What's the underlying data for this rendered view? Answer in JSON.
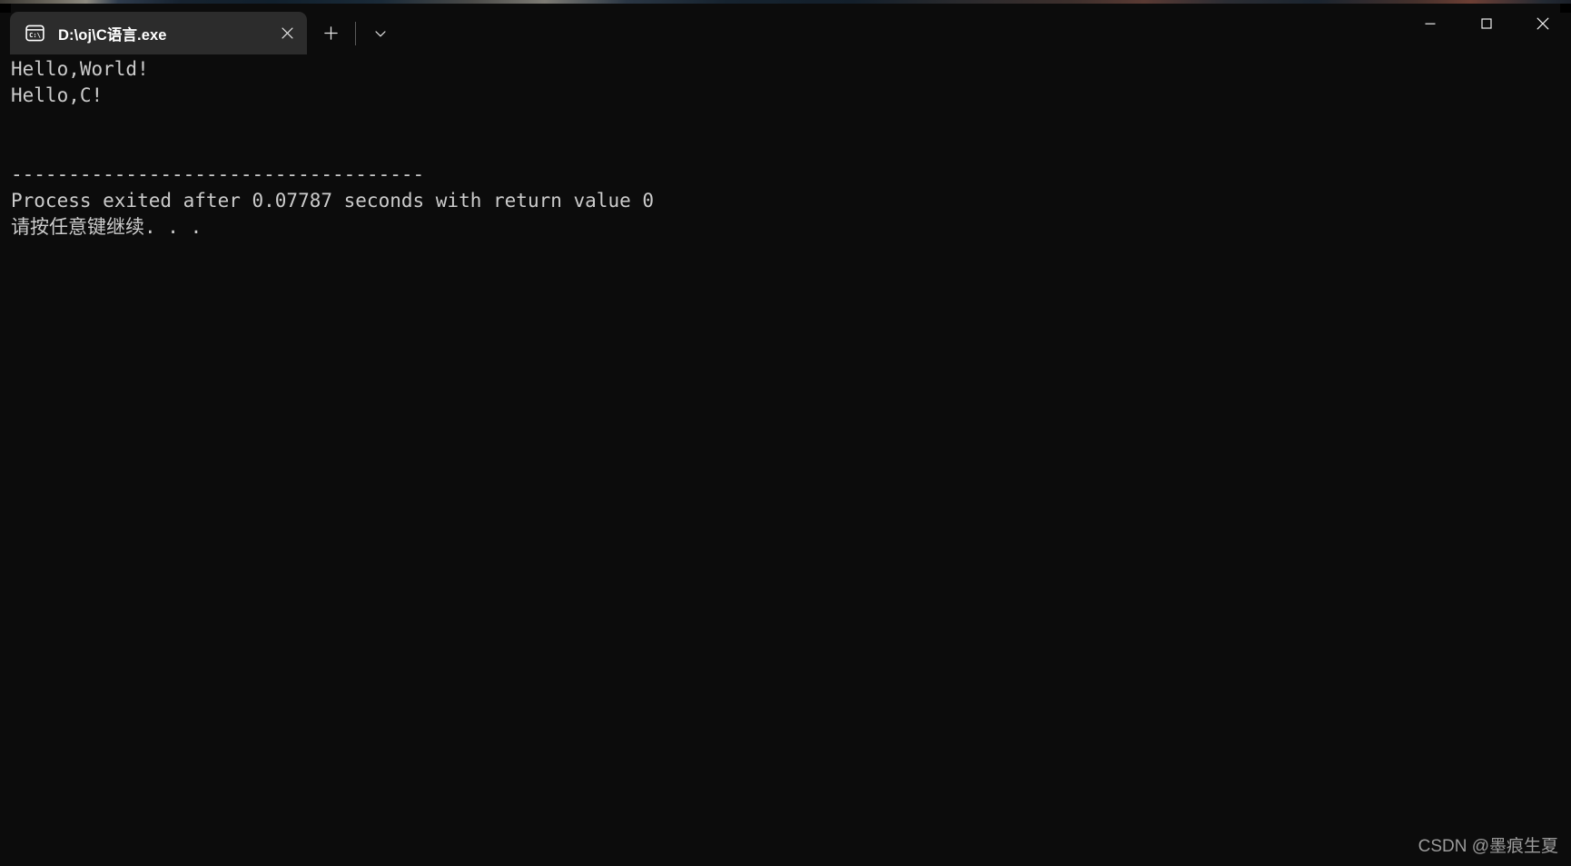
{
  "window": {
    "tabs": [
      {
        "title": "D:\\oj\\C语言.exe",
        "icon": "console-icon",
        "close_label": "×",
        "active": true
      }
    ],
    "new_tab_label": "+",
    "dropdown_label": "⌄",
    "caption_buttons": {
      "minimize": "—",
      "maximize": "□",
      "close": "×"
    }
  },
  "terminal": {
    "background_color": "#0c0c0c",
    "foreground_color": "#cccccc",
    "lines": [
      "Hello,World!",
      "Hello,C!",
      "",
      "",
      "------------------------------------",
      "Process exited after 0.07787 seconds with return value 0",
      "请按任意键继续. . ."
    ],
    "output_text": "Hello,World!\nHello,C!\n\n\n------------------------------------\nProcess exited after 0.07787 seconds with return value 0\n请按任意键继续. . ."
  },
  "watermark": {
    "text": "CSDN @墨痕生夏"
  }
}
